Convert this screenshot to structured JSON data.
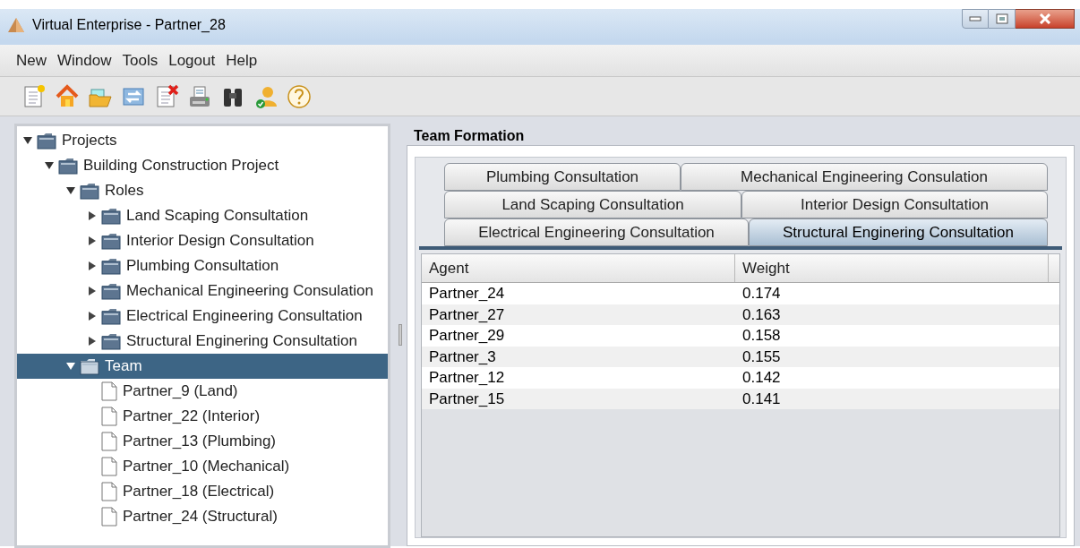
{
  "window": {
    "title": "Virtual Enterprise - Partner_28"
  },
  "menu": [
    "New",
    "Window",
    "Tools",
    "Logout",
    "Help"
  ],
  "tree": [
    {
      "label": "Projects",
      "kind": "folder",
      "expanded": true,
      "selected": false,
      "children": [
        {
          "label": "Building Construction Project",
          "kind": "folder",
          "expanded": true,
          "selected": false,
          "children": [
            {
              "label": "Roles",
              "kind": "folder",
              "expanded": true,
              "selected": false,
              "children": [
                {
                  "label": "Land Scaping Consultation",
                  "kind": "folder",
                  "expanded": false,
                  "selected": false
                },
                {
                  "label": "Interior Design Consultation",
                  "kind": "folder",
                  "expanded": false,
                  "selected": false
                },
                {
                  "label": "Plumbing Consultation",
                  "kind": "folder",
                  "expanded": false,
                  "selected": false
                },
                {
                  "label": "Mechanical Engineering Consulation",
                  "kind": "folder",
                  "expanded": false,
                  "selected": false
                },
                {
                  "label": "Electrical Engineering Consultation",
                  "kind": "folder",
                  "expanded": false,
                  "selected": false
                },
                {
                  "label": "Structural Enginering Consultation",
                  "kind": "folder",
                  "expanded": false,
                  "selected": false
                }
              ]
            },
            {
              "label": "Team",
              "kind": "folder",
              "expanded": true,
              "selected": true,
              "children": [
                {
                  "label": "Partner_9 (Land)",
                  "kind": "file",
                  "selected": false
                },
                {
                  "label": "Partner_22 (Interior)",
                  "kind": "file",
                  "selected": false
                },
                {
                  "label": "Partner_13 (Plumbing)",
                  "kind": "file",
                  "selected": false
                },
                {
                  "label": "Partner_10 (Mechanical)",
                  "kind": "file",
                  "selected": false
                },
                {
                  "label": "Partner_18 (Electrical)",
                  "kind": "file",
                  "selected": false
                },
                {
                  "label": "Partner_24 (Structural)",
                  "kind": "file",
                  "selected": false
                }
              ]
            }
          ]
        }
      ]
    }
  ],
  "panel": {
    "title": "Team Formation",
    "tab_rows": [
      [
        {
          "label": "Plumbing Consultation",
          "selected": false
        },
        {
          "label": "Mechanical Engineering Consulation",
          "selected": false
        }
      ],
      [
        {
          "label": "Land Scaping Consultation",
          "selected": false
        },
        {
          "label": "Interior Design Consultation",
          "selected": false
        }
      ],
      [
        {
          "label": "Electrical Engineering Consultation",
          "selected": false
        },
        {
          "label": "Structural Enginering Consultation",
          "selected": true
        }
      ]
    ],
    "table": {
      "columns": [
        "Agent",
        "Weight"
      ],
      "rows": [
        [
          "Partner_24",
          "0.174"
        ],
        [
          "Partner_27",
          "0.163"
        ],
        [
          "Partner_29",
          "0.158"
        ],
        [
          "Partner_3",
          "0.155"
        ],
        [
          "Partner_12",
          "0.142"
        ],
        [
          "Partner_15",
          "0.141"
        ]
      ]
    }
  }
}
